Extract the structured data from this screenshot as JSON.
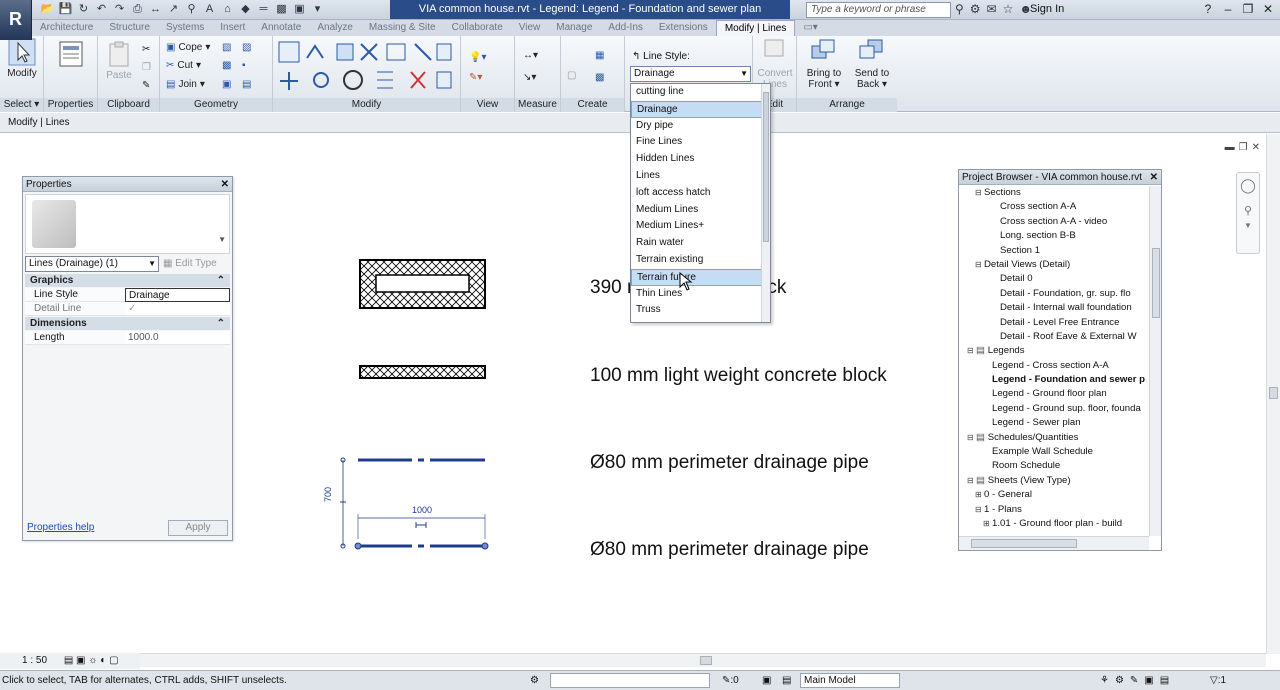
{
  "window": {
    "title": "VIA common house.rvt - Legend: Legend - Foundation and sewer plan",
    "search_placeholder": "Type a keyword or phrase",
    "sign_in": "Sign In"
  },
  "tabs": [
    "Architecture",
    "Structure",
    "Systems",
    "Insert",
    "Annotate",
    "Analyze",
    "Massing & Site",
    "Collaborate",
    "View",
    "Manage",
    "Add-Ins",
    "Extensions",
    "Modify | Lines"
  ],
  "active_tab": "Modify | Lines",
  "ribbon": {
    "select": {
      "modify_label": "Modify",
      "panel_label": "Select"
    },
    "properties": {
      "button_label": "Properties",
      "panel_label": "Properties"
    },
    "clipboard": {
      "paste_label": "Paste",
      "panel_label": "Clipboard"
    },
    "geometry": {
      "cope_label": "Cope",
      "cut_label": "Cut",
      "join_label": "Join",
      "panel_label": "Geometry"
    },
    "modify": {
      "panel_label": "Modify"
    },
    "view": {
      "panel_label": "View"
    },
    "measure": {
      "panel_label": "Measure"
    },
    "create": {
      "panel_label": "Create"
    },
    "line_style": {
      "label": "Line Style:",
      "value": "Drainage"
    },
    "edit": {
      "convert_label_1": "Convert",
      "convert_label_2": "Lines",
      "panel_label": "Edit"
    },
    "arrange": {
      "front_1": "Bring to",
      "front_2": "Front",
      "back_1": "Send to",
      "back_2": "Back",
      "panel_label": "Arrange"
    }
  },
  "context_bar": "Modify | Lines",
  "line_style_dropdown": {
    "items": [
      "cutting line",
      "Drainage",
      "Dry pipe",
      "Fine Lines",
      "Hidden Lines",
      "Lines",
      "loft access hatch",
      "Medium Lines",
      "Medium Lines+",
      "Rain water",
      "Terrain existing",
      "Terrain future",
      "Thin Lines",
      "Truss"
    ],
    "selected": "Drainage",
    "hovered": "Terrain future"
  },
  "properties_palette": {
    "title": "Properties",
    "type_selector": "Lines (Drainage) (1)",
    "edit_type": "Edit Type",
    "groups": [
      {
        "name": "Graphics",
        "rows": [
          {
            "key": "Line Style",
            "value": "Drainage"
          },
          {
            "key": "Detail Line",
            "value": "✓"
          }
        ]
      },
      {
        "name": "Dimensions",
        "rows": [
          {
            "key": "Length",
            "value": "1000.0"
          }
        ]
      }
    ],
    "help_link": "Properties help",
    "apply": "Apply"
  },
  "legend": {
    "labels": [
      "390 mm concrete block",
      "100 mm light weight concrete block",
      "Ø80 mm perimeter drainage pipe",
      "Ø80 mm perimeter drainage pipe"
    ],
    "dim_vertical": "700",
    "dim_horizontal": "1000"
  },
  "project_browser": {
    "title": "Project Browser - VIA common house.rvt",
    "nodes": [
      {
        "indent": 1,
        "toggle": "⊟",
        "label": "Sections"
      },
      {
        "indent": 3,
        "toggle": "",
        "label": "Cross section A-A"
      },
      {
        "indent": 3,
        "toggle": "",
        "label": "Cross section A-A - video"
      },
      {
        "indent": 3,
        "toggle": "",
        "label": "Long. section B-B"
      },
      {
        "indent": 3,
        "toggle": "",
        "label": "Section 1"
      },
      {
        "indent": 1,
        "toggle": "⊟",
        "label": "Detail Views (Detail)"
      },
      {
        "indent": 3,
        "toggle": "",
        "label": "Detail 0"
      },
      {
        "indent": 3,
        "toggle": "",
        "label": "Detail - Foundation, gr. sup. flo"
      },
      {
        "indent": 3,
        "toggle": "",
        "label": "Detail - Internal wall foundation"
      },
      {
        "indent": 3,
        "toggle": "",
        "label": "Detail - Level Free Entrance"
      },
      {
        "indent": 3,
        "toggle": "",
        "label": "Detail - Roof Eave & External W"
      },
      {
        "indent": 0,
        "toggle": "⊟",
        "label": "Legends",
        "icon": true
      },
      {
        "indent": 2,
        "toggle": "",
        "label": "Legend - Cross section A-A"
      },
      {
        "indent": 2,
        "toggle": "",
        "label": "Legend - Foundation and sewer p",
        "bold": true
      },
      {
        "indent": 2,
        "toggle": "",
        "label": "Legend - Ground floor plan"
      },
      {
        "indent": 2,
        "toggle": "",
        "label": "Legend - Ground sup. floor, founda"
      },
      {
        "indent": 2,
        "toggle": "",
        "label": "Legend - Sewer plan"
      },
      {
        "indent": 0,
        "toggle": "⊟",
        "label": "Schedules/Quantities",
        "icon": true
      },
      {
        "indent": 2,
        "toggle": "",
        "label": "Example Wall Schedule"
      },
      {
        "indent": 2,
        "toggle": "",
        "label": "Room Schedule"
      },
      {
        "indent": 0,
        "toggle": "⊟",
        "label": "Sheets (View Type)",
        "icon": true
      },
      {
        "indent": 1,
        "toggle": "⊞",
        "label": "0 - General"
      },
      {
        "indent": 1,
        "toggle": "⊟",
        "label": "1 - Plans"
      },
      {
        "indent": 2,
        "toggle": "⊞",
        "label": "1.01 - Ground floor plan - build"
      }
    ]
  },
  "view_control": {
    "scale": "1 : 50"
  },
  "status": {
    "message": "Click to select, TAB for alternates, CTRL adds, SHIFT unselects.",
    "workset_count": ":0",
    "model": "Main Model",
    "filter_count": ":1"
  }
}
